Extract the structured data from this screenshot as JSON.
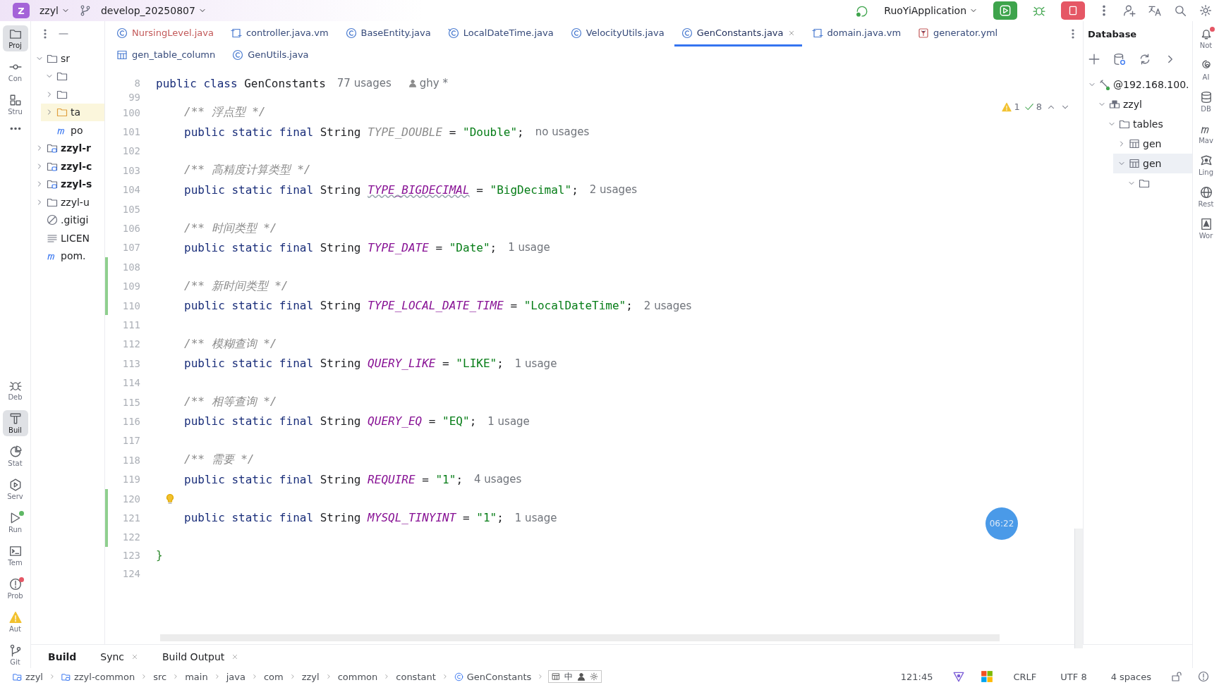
{
  "title_bar": {
    "project_badge": "Z",
    "project": "zzyl",
    "branch": "develop_20250807",
    "run_config": "RuoYiApplication"
  },
  "left_toolbar": [
    {
      "label": "Proj",
      "kind": "folder",
      "selected": true
    },
    {
      "label": "Con",
      "kind": "commit",
      "selected": false
    },
    {
      "label": "Stru",
      "kind": "structure",
      "selected": false
    },
    {
      "kind": "dots",
      "selected": false
    },
    {
      "label": "Deb",
      "kind": "bug",
      "selected": false
    },
    {
      "label": "Buil",
      "kind": "hammer",
      "selected": true
    },
    {
      "label": "Stat",
      "kind": "pie",
      "selected": false
    },
    {
      "label": "Serv",
      "kind": "service",
      "selected": false
    },
    {
      "label": "Run",
      "kind": "run",
      "selected": false,
      "color": "#5fb865"
    },
    {
      "label": "Tem",
      "kind": "terminal",
      "selected": false
    },
    {
      "label": "Prob",
      "kind": "alert",
      "selected": false,
      "color": "#e55765"
    },
    {
      "label": "Aut",
      "kind": "warning",
      "selected": false
    },
    {
      "label": "Git",
      "kind": "git",
      "selected": false
    }
  ],
  "project_tree": [
    {
      "label": "sr",
      "kind": "folder",
      "expanded": true,
      "children": [
        {
          "kind": "folder",
          "expanded": true
        },
        {
          "kind": "folder",
          "expanded": false
        },
        {
          "label": "ta",
          "kind": "folder",
          "expanded": false,
          "selected": true
        },
        {
          "label": "po",
          "kind": "maven"
        }
      ]
    },
    {
      "label": "zzyl-r",
      "kind": "module",
      "expanded": false
    },
    {
      "label": "zzyl-c",
      "kind": "module",
      "expanded": false
    },
    {
      "label": "zzyl-s",
      "kind": "module",
      "expanded": false
    },
    {
      "label": "zzyl-u",
      "kind": "folder",
      "expanded": false
    },
    {
      "label": ".gitigi",
      "kind": "ignore"
    },
    {
      "label": "LICEN",
      "kind": "text"
    },
    {
      "label": "pom.",
      "kind": "maven"
    }
  ],
  "editor_tabs": [
    [
      {
        "label": "NursingLevel.java",
        "kind": "class",
        "selected": false,
        "modified": true
      },
      {
        "label": "controller.java.vm",
        "kind": "template",
        "selected": false,
        "modified": false
      },
      {
        "label": "BaseEntity.java",
        "kind": "class",
        "selected": false,
        "modified": false
      },
      {
        "label": "LocalDateTime.java",
        "kind": "class-lib",
        "selected": false,
        "modified": false
      },
      {
        "label": "VelocityUtils.java",
        "kind": "class",
        "selected": false,
        "modified": false
      },
      {
        "label": "GenConstants.java",
        "kind": "class",
        "selected": true,
        "modified": false,
        "closable": true
      },
      {
        "label": "domain.java.vm",
        "kind": "template",
        "selected": false,
        "modified": false
      },
      {
        "label": "generator.yml",
        "kind": "yaml",
        "selected": false,
        "modified": false
      }
    ],
    [
      {
        "label": "gen_table_column",
        "kind": "table",
        "selected": false,
        "modified": false
      },
      {
        "label": "GenUtils.java",
        "kind": "class",
        "selected": false,
        "modified": false
      }
    ]
  ],
  "inspections": {
    "warnings": "1",
    "passed": "8"
  },
  "code_lines": [
    {
      "number": "8",
      "kind": "header",
      "tokens": [
        {
          "t": "public class",
          "kind": "keyword"
        },
        {
          "t": "GenConstants",
          "kind": "type"
        }
      ],
      "usages": "77 usages",
      "author": "ghy *"
    },
    {
      "number": "99",
      "kind": "cut"
    },
    {
      "number": "100",
      "kind": "member",
      "tokens": [
        {
          "t": "/** 浮点型 */",
          "kind": "comment"
        }
      ]
    },
    {
      "number": "101",
      "kind": "member",
      "tokens": [
        {
          "t": "public static final",
          "kind": "keyword"
        },
        {
          "t": "String",
          "kind": "type"
        },
        {
          "t": "TYPE_DOUBLE",
          "kind": "unused"
        },
        {
          "t": "=",
          "kind": "plain"
        },
        {
          "t": "\"Double\"",
          "kind": "string"
        },
        {
          "t": ";",
          "kind": "punct"
        }
      ],
      "usages": "no usages"
    },
    {
      "number": "102",
      "kind": "blank"
    },
    {
      "number": "103",
      "kind": "member",
      "tokens": [
        {
          "t": "/** 高精度计算类型 */",
          "kind": "comment"
        }
      ]
    },
    {
      "number": "104",
      "kind": "member",
      "tokens": [
        {
          "t": "public static final",
          "kind": "keyword"
        },
        {
          "t": "String",
          "kind": "type"
        },
        {
          "t": "TYPE_BIGDECIMAL",
          "kind": "typo"
        },
        {
          "t": "=",
          "kind": "plain"
        },
        {
          "t": "\"BigDecimal\"",
          "kind": "string"
        },
        {
          "t": ";",
          "kind": "punct"
        }
      ],
      "usages": "2 usages"
    },
    {
      "number": "105",
      "kind": "blank"
    },
    {
      "number": "106",
      "kind": "member",
      "tokens": [
        {
          "t": "/** 时间类型 */",
          "kind": "comment"
        }
      ]
    },
    {
      "number": "107",
      "kind": "member",
      "tokens": [
        {
          "t": "public static final",
          "kind": "keyword"
        },
        {
          "t": "String",
          "kind": "type"
        },
        {
          "t": "TYPE_DATE",
          "kind": "field"
        },
        {
          "t": "=",
          "kind": "plain"
        },
        {
          "t": "\"Date\"",
          "kind": "string"
        },
        {
          "t": ";",
          "kind": "punct"
        }
      ],
      "usages": "1 usage"
    },
    {
      "number": "108",
      "kind": "blank",
      "changed": true
    },
    {
      "number": "109",
      "kind": "member",
      "changed": true,
      "tokens": [
        {
          "t": "/** 新时间类型 */",
          "kind": "comment"
        }
      ]
    },
    {
      "number": "110",
      "kind": "member",
      "changed": true,
      "tokens": [
        {
          "t": "public static final",
          "kind": "keyword"
        },
        {
          "t": "String",
          "kind": "type"
        },
        {
          "t": "TYPE_LOCAL_DATE_TIME",
          "kind": "field"
        },
        {
          "t": "=",
          "kind": "plain"
        },
        {
          "t": "\"LocalDateTime\"",
          "kind": "string"
        },
        {
          "t": ";",
          "kind": "punct"
        }
      ],
      "usages": "2 usages"
    },
    {
      "number": "111",
      "kind": "blank"
    },
    {
      "number": "112",
      "kind": "member",
      "tokens": [
        {
          "t": "/** 模糊查询 */",
          "kind": "comment"
        }
      ]
    },
    {
      "number": "113",
      "kind": "member",
      "tokens": [
        {
          "t": "public static final",
          "kind": "keyword"
        },
        {
          "t": "String",
          "kind": "type"
        },
        {
          "t": "QUERY_LIKE",
          "kind": "field"
        },
        {
          "t": "=",
          "kind": "plain"
        },
        {
          "t": "\"LIKE\"",
          "kind": "string"
        },
        {
          "t": ";",
          "kind": "punct"
        }
      ],
      "usages": "1 usage"
    },
    {
      "number": "114",
      "kind": "blank"
    },
    {
      "number": "115",
      "kind": "member",
      "tokens": [
        {
          "t": "/** 相等查询 */",
          "kind": "comment"
        }
      ]
    },
    {
      "number": "116",
      "kind": "member",
      "tokens": [
        {
          "t": "public static final",
          "kind": "keyword"
        },
        {
          "t": "String",
          "kind": "type"
        },
        {
          "t": "QUERY_EQ",
          "kind": "field"
        },
        {
          "t": "=",
          "kind": "plain"
        },
        {
          "t": "\"EQ\"",
          "kind": "string"
        },
        {
          "t": ";",
          "kind": "punct"
        }
      ],
      "usages": "1 usage"
    },
    {
      "number": "117",
      "kind": "blank"
    },
    {
      "number": "118",
      "kind": "member",
      "tokens": [
        {
          "t": "/** 需要 */",
          "kind": "comment"
        }
      ]
    },
    {
      "number": "119",
      "kind": "member",
      "tokens": [
        {
          "t": "public static final",
          "kind": "keyword"
        },
        {
          "t": "String",
          "kind": "type"
        },
        {
          "t": "REQUIRE",
          "kind": "field"
        },
        {
          "t": "=",
          "kind": "plain"
        },
        {
          "t": "\"1\"",
          "kind": "string"
        },
        {
          "t": ";",
          "kind": "punct"
        }
      ],
      "usages": "4 usages"
    },
    {
      "number": "120",
      "kind": "blank",
      "changed": true,
      "bulb": true
    },
    {
      "number": "121",
      "kind": "member",
      "changed": true,
      "tokens": [
        {
          "t": "public static final",
          "kind": "keyword"
        },
        {
          "t": "String",
          "kind": "type"
        },
        {
          "t": "MYSQL_TINYINT",
          "kind": "field"
        },
        {
          "t": "=",
          "kind": "plain"
        },
        {
          "t": "\"1\"",
          "kind": "string"
        },
        {
          "t": ";",
          "kind": "punct"
        }
      ],
      "usages": "1 usage"
    },
    {
      "number": "122",
      "kind": "blank",
      "changed": true
    },
    {
      "number": "123",
      "kind": "header",
      "tokens": [
        {
          "t": "}",
          "kind": "brace"
        }
      ]
    },
    {
      "number": "124",
      "kind": "blank"
    }
  ],
  "timer": "06:22",
  "database": {
    "title": "Database",
    "tree": [
      {
        "label": "@192.168.100.",
        "kind": "server",
        "expanded": true,
        "children": [
          {
            "label": "zzyl",
            "kind": "schema",
            "expanded": true,
            "children": [
              {
                "label": "tables",
                "kind": "folder",
                "expanded": true,
                "children": [
                  {
                    "label": "gen",
                    "kind": "table",
                    "expanded": false,
                    "selected": false
                  },
                  {
                    "label": "gen",
                    "kind": "table",
                    "expanded": true,
                    "selected": true,
                    "children": [
                      {
                        "kind": "folder",
                        "expanded": true
                      }
                    ]
                  }
                ]
              }
            ]
          }
        ]
      }
    ]
  },
  "right_toolbar": [
    {
      "label": "Not",
      "kind": "bell",
      "color": "#e55765"
    },
    {
      "label": "AI",
      "kind": "spiral"
    },
    {
      "label": "DB",
      "kind": "db"
    },
    {
      "label": "Mav",
      "kind": "maven"
    },
    {
      "label": "Ling",
      "kind": "ling"
    },
    {
      "label": "Rest",
      "kind": "globe"
    },
    {
      "label": "Wor",
      "kind": "doc"
    }
  ],
  "bottom_tabs": [
    {
      "label": "Build",
      "selected": true,
      "closable": false
    },
    {
      "label": "Sync",
      "selected": false,
      "closable": true
    },
    {
      "label": "Build Output",
      "selected": false,
      "closable": true
    }
  ],
  "breadcrumbs": [
    {
      "label": "zzyl",
      "kind": "module"
    },
    {
      "label": "zzyl-common",
      "kind": "module"
    },
    {
      "label": "src",
      "kind": "plain"
    },
    {
      "label": "main",
      "kind": "plain"
    },
    {
      "label": "java",
      "kind": "plain"
    },
    {
      "label": "com",
      "kind": "plain"
    },
    {
      "label": "zzyl",
      "kind": "plain"
    },
    {
      "label": "common",
      "kind": "plain"
    },
    {
      "label": "constant",
      "kind": "plain"
    },
    {
      "label": "GenConstants",
      "kind": "class"
    }
  ],
  "ime_toolbar": {
    "mode": "中"
  },
  "status": {
    "position": "121:45",
    "line_separator": "CRLF",
    "encoding": "UTF 8",
    "indent": "4 spaces"
  }
}
